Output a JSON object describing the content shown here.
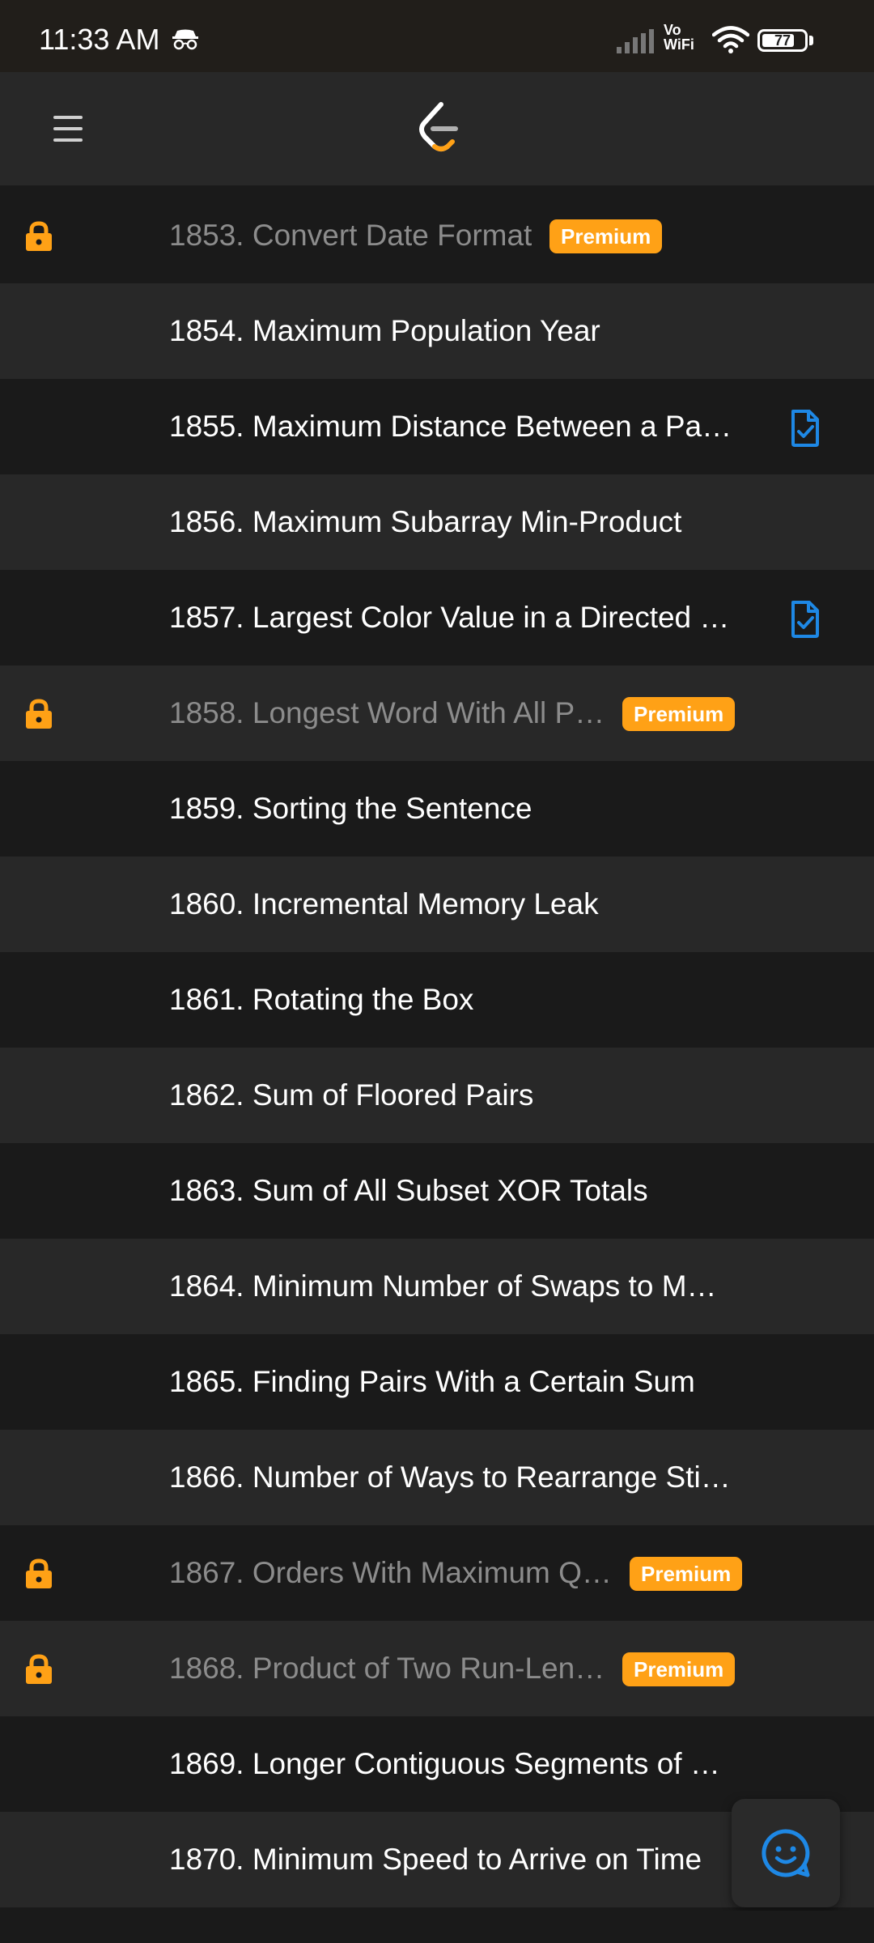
{
  "status_bar": {
    "time": "11:33 AM",
    "network_label_top": "Vo",
    "network_label_bottom": "WiFi",
    "battery_percent": "77",
    "battery_level": 0.77,
    "icons": [
      "incognito-icon",
      "signal-icon",
      "wifi-icon",
      "battery-icon"
    ]
  },
  "header": {
    "menu_icon": "hamburger-menu-icon",
    "logo_icon": "leetcode-logo-icon"
  },
  "problems": [
    {
      "title": "1853. Convert Date Format",
      "locked": true,
      "badge": "Premium",
      "solution": false
    },
    {
      "title": "1854. Maximum Population Year",
      "locked": false,
      "badge": "",
      "solution": false
    },
    {
      "title": "1855. Maximum Distance Between a Pa…",
      "locked": false,
      "badge": "",
      "solution": true
    },
    {
      "title": "1856. Maximum Subarray Min-Product",
      "locked": false,
      "badge": "",
      "solution": false
    },
    {
      "title": "1857. Largest Color Value in a Directed …",
      "locked": false,
      "badge": "",
      "solution": true
    },
    {
      "title": "1858. Longest Word With All P…",
      "locked": true,
      "badge": "Premium",
      "solution": false
    },
    {
      "title": "1859. Sorting the Sentence",
      "locked": false,
      "badge": "",
      "solution": false
    },
    {
      "title": "1860. Incremental Memory Leak",
      "locked": false,
      "badge": "",
      "solution": false
    },
    {
      "title": "1861. Rotating the Box",
      "locked": false,
      "badge": "",
      "solution": false
    },
    {
      "title": "1862. Sum of Floored Pairs",
      "locked": false,
      "badge": "",
      "solution": false
    },
    {
      "title": "1863. Sum of All Subset XOR Totals",
      "locked": false,
      "badge": "",
      "solution": false
    },
    {
      "title": "1864. Minimum Number of Swaps to M…",
      "locked": false,
      "badge": "",
      "solution": false
    },
    {
      "title": "1865. Finding Pairs With a Certain Sum",
      "locked": false,
      "badge": "",
      "solution": false
    },
    {
      "title": "1866. Number of Ways to Rearrange Sti…",
      "locked": false,
      "badge": "",
      "solution": false
    },
    {
      "title": "1867. Orders With Maximum Q…",
      "locked": true,
      "badge": "Premium",
      "solution": false
    },
    {
      "title": "1868. Product of Two Run-Len…",
      "locked": true,
      "badge": "Premium",
      "solution": false
    },
    {
      "title": "1869. Longer Contiguous Segments of …",
      "locked": false,
      "badge": "",
      "solution": false
    },
    {
      "title": "1870. Minimum Speed to Arrive on Time",
      "locked": false,
      "badge": "",
      "solution": false
    }
  ],
  "fab": {
    "icon": "feedback-smiley-icon"
  },
  "colors": {
    "accent_premium": "#ffa116",
    "solution_icon": "#1e88e5",
    "row_dark": "#1a1a1a",
    "row_light": "#282828"
  }
}
